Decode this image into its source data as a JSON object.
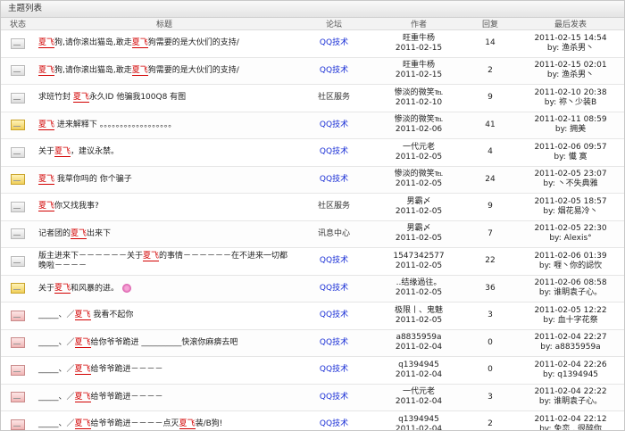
{
  "panel_title": "主题列表",
  "headers": {
    "status": "状态",
    "title": "标题",
    "forum": "论坛",
    "author": "作者",
    "replies": "回复",
    "last": "最后发表"
  },
  "rows": [
    {
      "icon": "plain",
      "title": [
        [
          "h",
          "夏飞"
        ],
        [
          "t",
          "狗,请你滚出猫岛,敢走"
        ],
        [
          "h",
          "夏飞"
        ],
        [
          "t",
          "狗需要的是大伙们的支持/"
        ]
      ],
      "forum": "QQ技术",
      "forum_link": true,
      "author": "旺重牛杨",
      "date": "2011-02-15",
      "replies": "14",
      "last_time": "2011-02-15 14:54",
      "last_by": "by: 渔杀男丶"
    },
    {
      "icon": "plain",
      "title": [
        [
          "h",
          "夏飞"
        ],
        [
          "t",
          "狗,请你滚出猫岛,敢走"
        ],
        [
          "h",
          "夏飞"
        ],
        [
          "t",
          "狗需要的是大伙们的支持/"
        ]
      ],
      "forum": "QQ技术",
      "forum_link": true,
      "author": "旺重牛杨",
      "date": "2011-02-15",
      "replies": "2",
      "last_time": "2011-02-15 02:01",
      "last_by": "by: 渔杀男丶"
    },
    {
      "icon": "plain",
      "title": [
        [
          "t",
          "求班竹封 "
        ],
        [
          "h",
          "夏飞"
        ],
        [
          "t",
          "永久ID 他骗我100Q8 有图"
        ]
      ],
      "forum": "社区服务",
      "forum_link": false,
      "author": "惨淡的微笑℡",
      "date": "2011-02-10",
      "replies": "9",
      "last_time": "2011-02-10 20:38",
      "last_by": "by: 祢丶少装B"
    },
    {
      "icon": "folder",
      "title": [
        [
          "h",
          "夏飞"
        ],
        [
          "t",
          " 进来解释下 。。。。。。。。。。。。。。。。。。"
        ]
      ],
      "forum": "QQ技术",
      "forum_link": true,
      "author": "惨淡的微笑℡",
      "date": "2011-02-06",
      "replies": "41",
      "last_time": "2011-02-11 08:59",
      "last_by": "by: 拥美"
    },
    {
      "icon": "plain",
      "title": [
        [
          "t",
          "关于"
        ],
        [
          "h",
          "夏飞"
        ],
        [
          "t",
          "，建议永禁。"
        ]
      ],
      "forum": "QQ技术",
      "forum_link": true,
      "author": "一代元老",
      "date": "2011-02-05",
      "replies": "4",
      "last_time": "2011-02-06 09:57",
      "last_by": "by: 懴      寞"
    },
    {
      "icon": "folder",
      "title": [
        [
          "h",
          "夏飞"
        ],
        [
          "t",
          " 我草你吗的  你个骗子"
        ]
      ],
      "forum": "QQ技术",
      "forum_link": true,
      "author": "惨淡的微笑℡",
      "date": "2011-02-05",
      "replies": "24",
      "last_time": "2011-02-05 23:07",
      "last_by": "by: 丶不失典雅"
    },
    {
      "icon": "plain",
      "title": [
        [
          "h",
          "夏飞"
        ],
        [
          "t",
          "你又找我事?"
        ]
      ],
      "forum": "社区服务",
      "forum_link": false,
      "author": "男霸〆",
      "date": "2011-02-05",
      "replies": "9",
      "last_time": "2011-02-05 18:57",
      "last_by": "by: 烟花易冷丶"
    },
    {
      "icon": "plain",
      "title": [
        [
          "t",
          "记者团的"
        ],
        [
          "h",
          "夏飞"
        ],
        [
          "t",
          "出来下"
        ]
      ],
      "forum": "讯息中心",
      "forum_link": false,
      "author": "男霸〆",
      "date": "2011-02-05",
      "replies": "7",
      "last_time": "2011-02-05 22:30",
      "last_by": "by:    Alexis°"
    },
    {
      "icon": "plain",
      "title": [
        [
          "t",
          "版主进来下－－－－－－关于"
        ],
        [
          "h",
          "夏飞"
        ],
        [
          "t",
          "的事情－－－－－－在不进来一切都晚啦－－－－"
        ]
      ],
      "forum": "QQ技术",
      "forum_link": true,
      "author": "1547342577",
      "date": "2011-02-05",
      "replies": "22",
      "last_time": "2011-02-06 01:39",
      "last_by": "by: 喱丶你的誋忺"
    },
    {
      "icon": "folder",
      "title": [
        [
          "t",
          "关于"
        ],
        [
          "h",
          "夏飞"
        ],
        [
          "t",
          "和风暴的进。"
        ]
      ],
      "emoji": true,
      "forum": "QQ技术",
      "forum_link": true,
      "author": "..结缘過往。",
      "date": "2011-02-05",
      "replies": "36",
      "last_time": "2011-02-06 08:58",
      "last_by": "by: 谁眀袁子心。"
    },
    {
      "icon": "hot",
      "title": [
        [
          "t",
          "_____、／"
        ],
        [
          "h",
          "夏飞"
        ],
        [
          "t",
          "  我看不起你"
        ]
      ],
      "forum": "QQ技术",
      "forum_link": true,
      "author": "极限丨、鬼魅",
      "date": "2011-02-05",
      "replies": "3",
      "last_time": "2011-02-05 12:22",
      "last_by": "by: 血十字花祭"
    },
    {
      "icon": "hot",
      "title": [
        [
          "t",
          "_____、／"
        ],
        [
          "h",
          "夏飞"
        ],
        [
          "t",
          "给你爷爷跪进 __________快滚你麻痹去吧"
        ]
      ],
      "forum": "QQ技术",
      "forum_link": true,
      "author": "a8835959a",
      "date": "2011-02-04",
      "replies": "0",
      "last_time": "2011-02-04 22:27",
      "last_by": "by: a8835959a"
    },
    {
      "icon": "hot",
      "title": [
        [
          "t",
          "_____、／"
        ],
        [
          "h",
          "夏飞"
        ],
        [
          "t",
          "给爷爷跪进－－－－"
        ]
      ],
      "forum": "QQ技术",
      "forum_link": true,
      "author": "q1394945",
      "date": "2011-02-04",
      "replies": "0",
      "last_time": "2011-02-04 22:26",
      "last_by": "by: q1394945"
    },
    {
      "icon": "hot",
      "title": [
        [
          "t",
          "_____、／"
        ],
        [
          "h",
          "夏飞"
        ],
        [
          "t",
          "给爷爷跪进－－－－"
        ]
      ],
      "forum": "QQ技术",
      "forum_link": true,
      "author": "一代元老",
      "date": "2011-02-04",
      "replies": "3",
      "last_time": "2011-02-04 22:22",
      "last_by": "by: 谁眀袁子心。"
    },
    {
      "icon": "hot",
      "title": [
        [
          "t",
          "_____、／"
        ],
        [
          "h",
          "夏飞"
        ],
        [
          "t",
          "给爷爷跪进－－－－点灭"
        ],
        [
          "h",
          "夏飞"
        ],
        [
          "t",
          "装/B狗!"
        ]
      ],
      "forum": "QQ技术",
      "forum_link": true,
      "author": "q1394945",
      "date": "2011-02-04",
      "replies": "2",
      "last_time": "2011-02-04 22:12",
      "last_by": "by: 免恋  , 很醉你"
    }
  ]
}
